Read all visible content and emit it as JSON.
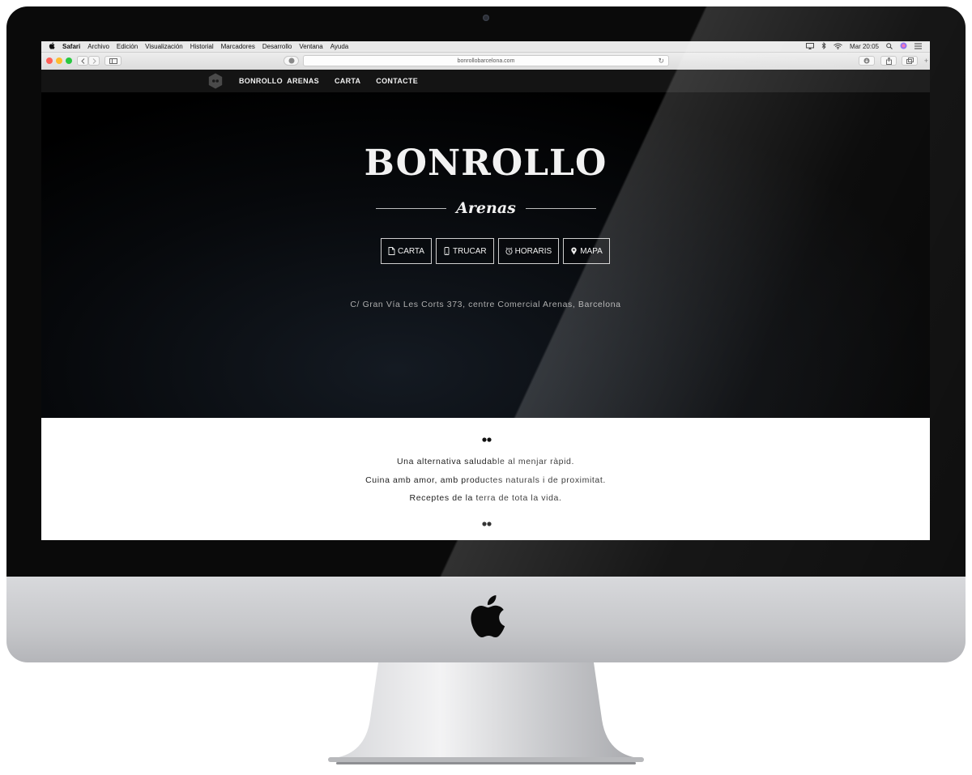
{
  "menubar": {
    "items": [
      "Safari",
      "Archivo",
      "Edición",
      "Visualización",
      "Historial",
      "Marcadores",
      "Desarrollo",
      "Ventana",
      "Ayuda"
    ],
    "clock": "Mar 20:05"
  },
  "browser": {
    "url": "bonrollobarcelona.com"
  },
  "nav": {
    "brand": "BONROLLO  ARENAS",
    "links": [
      "CARTA",
      "CONTACTE"
    ]
  },
  "hero": {
    "title": "BONROLLO",
    "subtitle": "Arenas",
    "buttons": [
      {
        "label": "CARTA",
        "icon": "document-icon"
      },
      {
        "label": "TRUCAR",
        "icon": "phone-icon"
      },
      {
        "label": "HORARIS",
        "icon": "alarm-clock-icon"
      },
      {
        "label": "MAPA",
        "icon": "map-pin-icon"
      }
    ],
    "address": "C/ Gran Vía Les Corts 373, centre Comercial Arenas, Barcelona"
  },
  "intro": {
    "lines": [
      "Una alternativa saludable al menjar ràpid.",
      "Cuina amb amor, amb productes naturals i de proximitat.",
      "Receptes de la terra de tota la vida."
    ]
  }
}
